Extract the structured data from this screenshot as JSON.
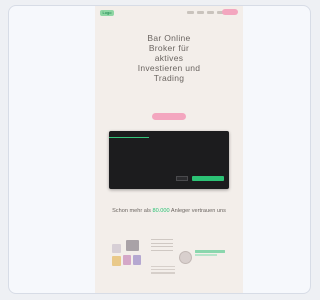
{
  "brand": {
    "logo_text": "Logo",
    "accent": "#f3a6bf",
    "green": "#2cc275"
  },
  "nav": {
    "links": [
      "",
      "",
      "",
      ""
    ],
    "cta_label": ""
  },
  "hero": {
    "title": "Bar Online\nBroker für\naktives\nInvestieren und\nTrading",
    "text": "",
    "button_label": ""
  },
  "cookie": {
    "tabs": [
      "",
      "",
      ""
    ],
    "heading": "",
    "body": "",
    "secondary_label": "",
    "primary_label": ""
  },
  "trust": {
    "prefix": "Schon mehr als ",
    "highlight": "80.000",
    "suffix": " Anleger vertrauen uns"
  },
  "rating": {
    "title": ""
  }
}
